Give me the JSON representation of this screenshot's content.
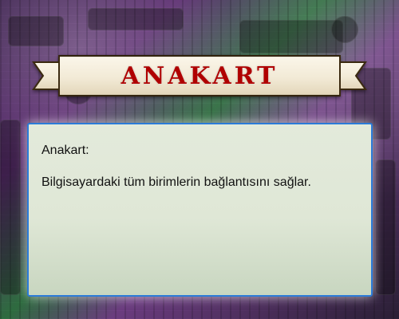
{
  "slide": {
    "banner_title": "ANAKART",
    "card": {
      "label": "Anakart:",
      "description": "Bilgisayardaki tüm birimlerin bağlantısını sağlar."
    }
  },
  "colors": {
    "banner_fill": "#f2ead6",
    "banner_stroke": "#3b2a10",
    "title": "#b00000",
    "card_border": "#2b7bd8",
    "card_bg_top": "#e3eadb",
    "card_bg_bottom": "#c8d6c0"
  }
}
